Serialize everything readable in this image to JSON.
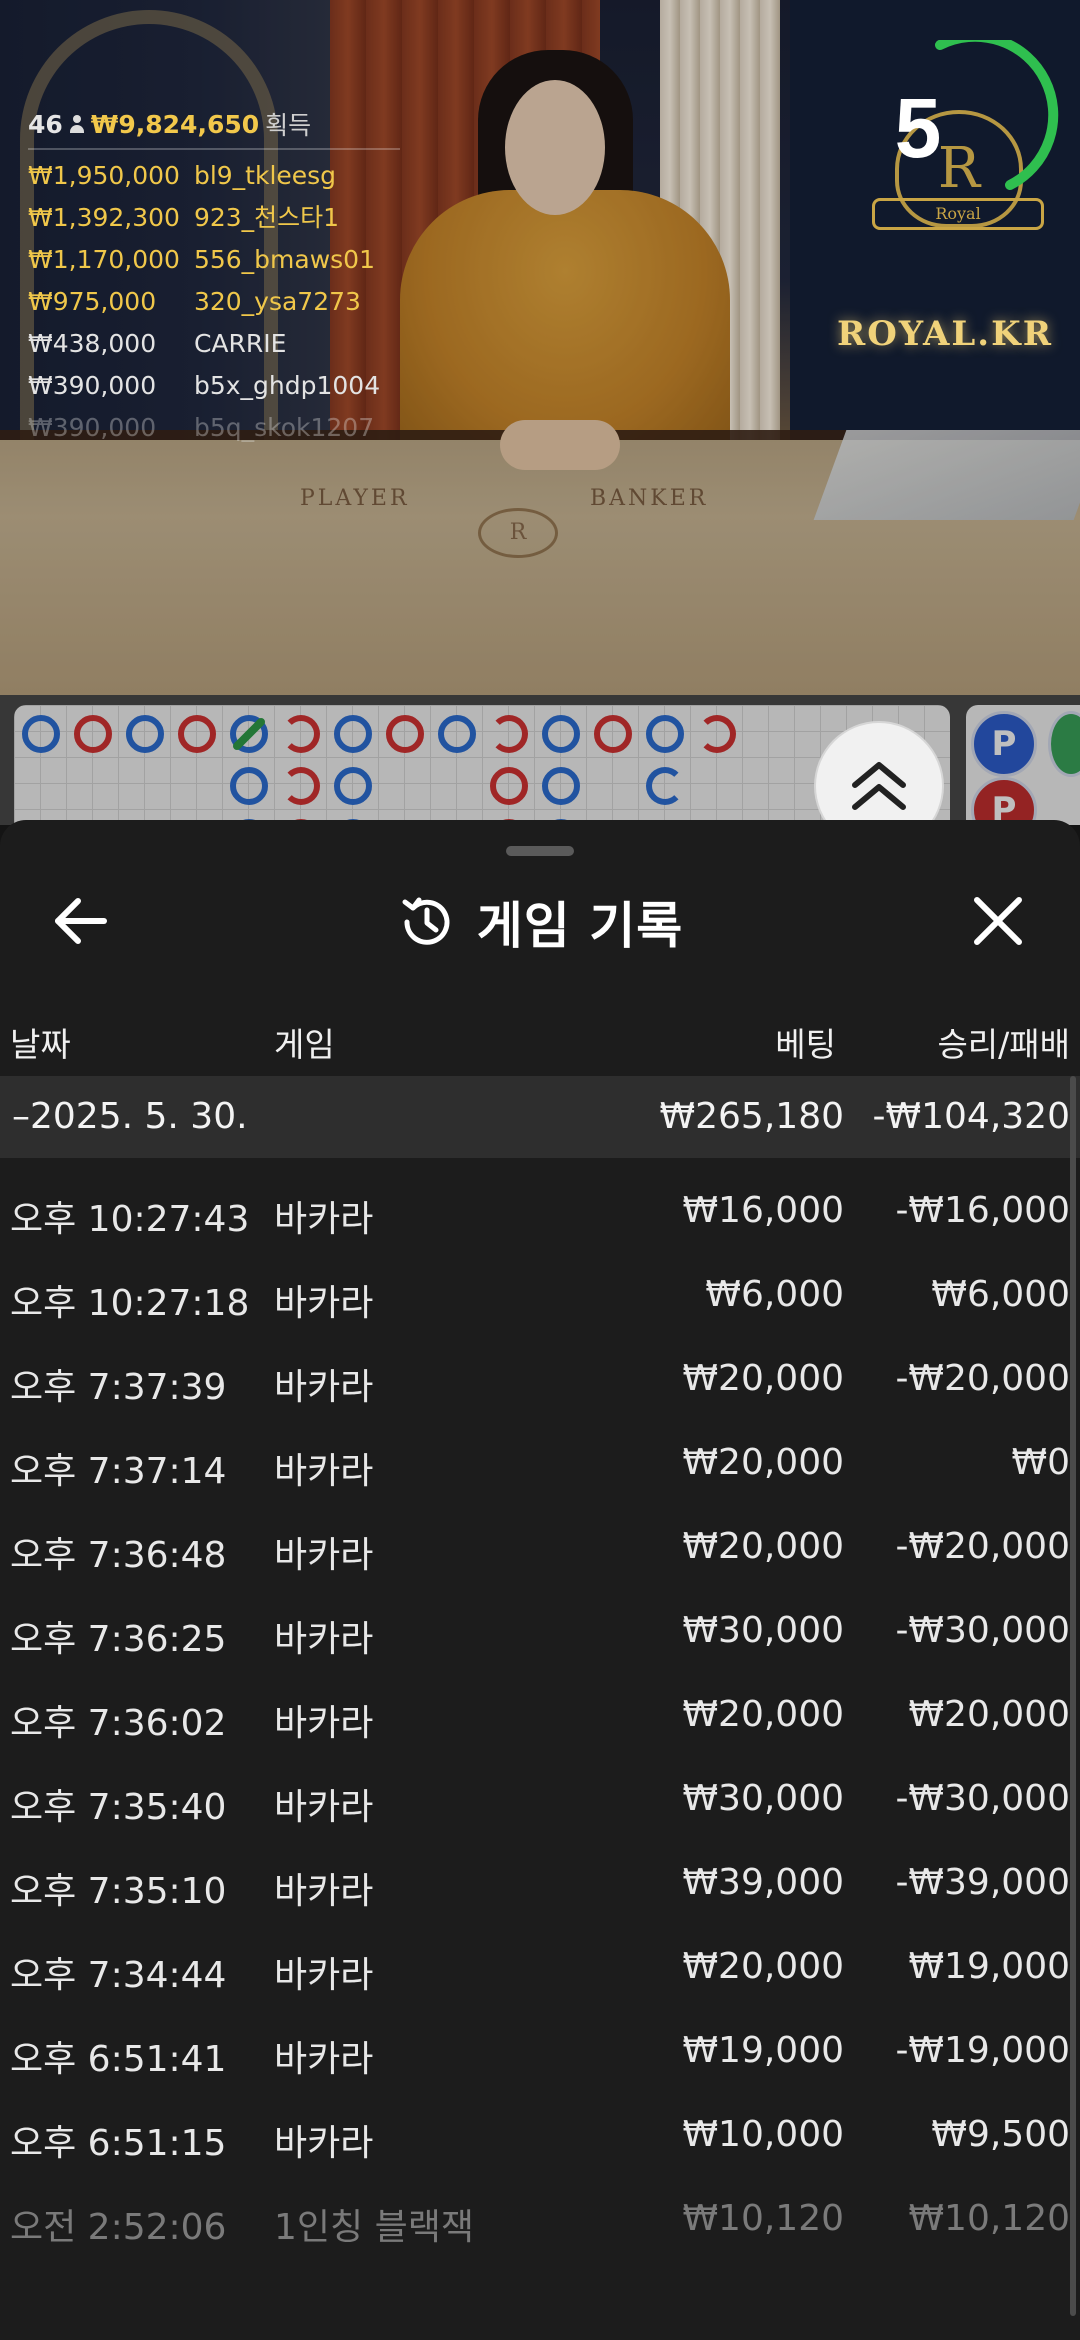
{
  "stream": {
    "timer_value": "5",
    "brand_text": "ROYAL.KR",
    "logo_letter": "R",
    "logo_ribbon": "Royal",
    "table_labels": {
      "player": "PLAYER",
      "banker": "BANKER"
    }
  },
  "winners": {
    "count": "46",
    "total": "₩9,824,650",
    "total_label": "획득",
    "list": [
      {
        "amount": "₩1,950,000",
        "name": "bl9_tkleesg"
      },
      {
        "amount": "₩1,392,300",
        "name": "923_천스타1"
      },
      {
        "amount": "₩1,170,000",
        "name": "556_bmaws01"
      },
      {
        "amount": "₩975,000",
        "name": "320_ysa7273"
      },
      {
        "amount": "₩438,000",
        "name": "CARRIE"
      },
      {
        "amount": "₩390,000",
        "name": "b5x_ghdp1004"
      },
      {
        "amount": "₩390,000",
        "name": "b5q_skok1207"
      }
    ]
  },
  "road_badges": [
    "P",
    "P"
  ],
  "history": {
    "title": "게임 기록",
    "icons": {
      "back": "arrow-left-icon",
      "history": "history-clock-icon",
      "close": "close-icon",
      "expand": "chevron-double-up-icon"
    },
    "columns": {
      "date": "날짜",
      "game": "게임",
      "bet": "베팅",
      "win_loss": "승리/패배"
    },
    "date_group": {
      "date": "–2025. 5. 30.",
      "bet_total": "₩265,180",
      "win_total": "-₩104,320"
    },
    "rows": [
      {
        "time": "오후 10:27:43",
        "game": "바카라",
        "bet": "₩16,000",
        "result": "-₩16,000"
      },
      {
        "time": "오후 10:27:18",
        "game": "바카라",
        "bet": "₩6,000",
        "result": "₩6,000"
      },
      {
        "time": "오후 7:37:39",
        "game": "바카라",
        "bet": "₩20,000",
        "result": "-₩20,000"
      },
      {
        "time": "오후 7:37:14",
        "game": "바카라",
        "bet": "₩20,000",
        "result": "₩0"
      },
      {
        "time": "오후 7:36:48",
        "game": "바카라",
        "bet": "₩20,000",
        "result": "-₩20,000"
      },
      {
        "time": "오후 7:36:25",
        "game": "바카라",
        "bet": "₩30,000",
        "result": "-₩30,000"
      },
      {
        "time": "오후 7:36:02",
        "game": "바카라",
        "bet": "₩20,000",
        "result": "₩20,000"
      },
      {
        "time": "오후 7:35:40",
        "game": "바카라",
        "bet": "₩30,000",
        "result": "-₩30,000"
      },
      {
        "time": "오후 7:35:10",
        "game": "바카라",
        "bet": "₩39,000",
        "result": "-₩39,000"
      },
      {
        "time": "오후 7:34:44",
        "game": "바카라",
        "bet": "₩20,000",
        "result": "₩19,000"
      },
      {
        "time": "오후 6:51:41",
        "game": "바카라",
        "bet": "₩19,000",
        "result": "-₩19,000"
      },
      {
        "time": "오후 6:51:15",
        "game": "바카라",
        "bet": "₩10,000",
        "result": "₩9,500"
      },
      {
        "time": "오전 2:52:06",
        "game": "1인칭 블랙잭",
        "bet": "₩10,120",
        "result": "₩10,120"
      }
    ]
  },
  "colors": {
    "sheet_bg": "#1c1c1c",
    "group_bg": "#2e2e2e",
    "gold": "#f0c74a",
    "timer_ring": "#2fbf4f",
    "banker": "#d63333",
    "player": "#2d6fd6"
  }
}
